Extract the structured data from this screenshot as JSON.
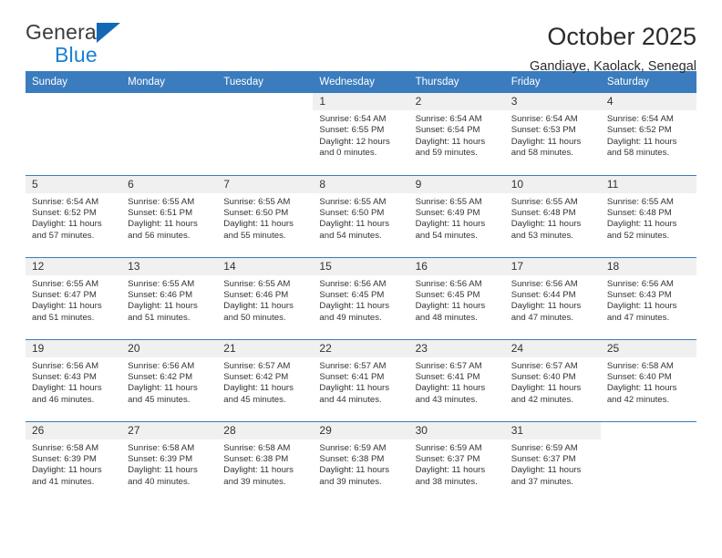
{
  "brand": {
    "name_top": "General",
    "name_bottom": "Blue",
    "accent_color": "#1368b5",
    "text_color": "#3b3b3b",
    "blue_text_color": "#1a7fd4"
  },
  "header": {
    "title": "October 2025",
    "subtitle": "Gandiaye, Kaolack, Senegal"
  },
  "theme": {
    "header_blue": "#3a7cbe",
    "daynum_band": "#f0f0f0",
    "body_text": "#333333"
  },
  "weekdays": [
    "Sunday",
    "Monday",
    "Tuesday",
    "Wednesday",
    "Thursday",
    "Friday",
    "Saturday"
  ],
  "weeks": [
    [
      {
        "day": "",
        "sunrise": "",
        "sunset": "",
        "daylight_1": "",
        "daylight_2": ""
      },
      {
        "day": "",
        "sunrise": "",
        "sunset": "",
        "daylight_1": "",
        "daylight_2": ""
      },
      {
        "day": "",
        "sunrise": "",
        "sunset": "",
        "daylight_1": "",
        "daylight_2": ""
      },
      {
        "day": "1",
        "sunrise": "Sunrise: 6:54 AM",
        "sunset": "Sunset: 6:55 PM",
        "daylight_1": "Daylight: 12 hours",
        "daylight_2": "and 0 minutes."
      },
      {
        "day": "2",
        "sunrise": "Sunrise: 6:54 AM",
        "sunset": "Sunset: 6:54 PM",
        "daylight_1": "Daylight: 11 hours",
        "daylight_2": "and 59 minutes."
      },
      {
        "day": "3",
        "sunrise": "Sunrise: 6:54 AM",
        "sunset": "Sunset: 6:53 PM",
        "daylight_1": "Daylight: 11 hours",
        "daylight_2": "and 58 minutes."
      },
      {
        "day": "4",
        "sunrise": "Sunrise: 6:54 AM",
        "sunset": "Sunset: 6:52 PM",
        "daylight_1": "Daylight: 11 hours",
        "daylight_2": "and 58 minutes."
      }
    ],
    [
      {
        "day": "5",
        "sunrise": "Sunrise: 6:54 AM",
        "sunset": "Sunset: 6:52 PM",
        "daylight_1": "Daylight: 11 hours",
        "daylight_2": "and 57 minutes."
      },
      {
        "day": "6",
        "sunrise": "Sunrise: 6:55 AM",
        "sunset": "Sunset: 6:51 PM",
        "daylight_1": "Daylight: 11 hours",
        "daylight_2": "and 56 minutes."
      },
      {
        "day": "7",
        "sunrise": "Sunrise: 6:55 AM",
        "sunset": "Sunset: 6:50 PM",
        "daylight_1": "Daylight: 11 hours",
        "daylight_2": "and 55 minutes."
      },
      {
        "day": "8",
        "sunrise": "Sunrise: 6:55 AM",
        "sunset": "Sunset: 6:50 PM",
        "daylight_1": "Daylight: 11 hours",
        "daylight_2": "and 54 minutes."
      },
      {
        "day": "9",
        "sunrise": "Sunrise: 6:55 AM",
        "sunset": "Sunset: 6:49 PM",
        "daylight_1": "Daylight: 11 hours",
        "daylight_2": "and 54 minutes."
      },
      {
        "day": "10",
        "sunrise": "Sunrise: 6:55 AM",
        "sunset": "Sunset: 6:48 PM",
        "daylight_1": "Daylight: 11 hours",
        "daylight_2": "and 53 minutes."
      },
      {
        "day": "11",
        "sunrise": "Sunrise: 6:55 AM",
        "sunset": "Sunset: 6:48 PM",
        "daylight_1": "Daylight: 11 hours",
        "daylight_2": "and 52 minutes."
      }
    ],
    [
      {
        "day": "12",
        "sunrise": "Sunrise: 6:55 AM",
        "sunset": "Sunset: 6:47 PM",
        "daylight_1": "Daylight: 11 hours",
        "daylight_2": "and 51 minutes."
      },
      {
        "day": "13",
        "sunrise": "Sunrise: 6:55 AM",
        "sunset": "Sunset: 6:46 PM",
        "daylight_1": "Daylight: 11 hours",
        "daylight_2": "and 51 minutes."
      },
      {
        "day": "14",
        "sunrise": "Sunrise: 6:55 AM",
        "sunset": "Sunset: 6:46 PM",
        "daylight_1": "Daylight: 11 hours",
        "daylight_2": "and 50 minutes."
      },
      {
        "day": "15",
        "sunrise": "Sunrise: 6:56 AM",
        "sunset": "Sunset: 6:45 PM",
        "daylight_1": "Daylight: 11 hours",
        "daylight_2": "and 49 minutes."
      },
      {
        "day": "16",
        "sunrise": "Sunrise: 6:56 AM",
        "sunset": "Sunset: 6:45 PM",
        "daylight_1": "Daylight: 11 hours",
        "daylight_2": "and 48 minutes."
      },
      {
        "day": "17",
        "sunrise": "Sunrise: 6:56 AM",
        "sunset": "Sunset: 6:44 PM",
        "daylight_1": "Daylight: 11 hours",
        "daylight_2": "and 47 minutes."
      },
      {
        "day": "18",
        "sunrise": "Sunrise: 6:56 AM",
        "sunset": "Sunset: 6:43 PM",
        "daylight_1": "Daylight: 11 hours",
        "daylight_2": "and 47 minutes."
      }
    ],
    [
      {
        "day": "19",
        "sunrise": "Sunrise: 6:56 AM",
        "sunset": "Sunset: 6:43 PM",
        "daylight_1": "Daylight: 11 hours",
        "daylight_2": "and 46 minutes."
      },
      {
        "day": "20",
        "sunrise": "Sunrise: 6:56 AM",
        "sunset": "Sunset: 6:42 PM",
        "daylight_1": "Daylight: 11 hours",
        "daylight_2": "and 45 minutes."
      },
      {
        "day": "21",
        "sunrise": "Sunrise: 6:57 AM",
        "sunset": "Sunset: 6:42 PM",
        "daylight_1": "Daylight: 11 hours",
        "daylight_2": "and 45 minutes."
      },
      {
        "day": "22",
        "sunrise": "Sunrise: 6:57 AM",
        "sunset": "Sunset: 6:41 PM",
        "daylight_1": "Daylight: 11 hours",
        "daylight_2": "and 44 minutes."
      },
      {
        "day": "23",
        "sunrise": "Sunrise: 6:57 AM",
        "sunset": "Sunset: 6:41 PM",
        "daylight_1": "Daylight: 11 hours",
        "daylight_2": "and 43 minutes."
      },
      {
        "day": "24",
        "sunrise": "Sunrise: 6:57 AM",
        "sunset": "Sunset: 6:40 PM",
        "daylight_1": "Daylight: 11 hours",
        "daylight_2": "and 42 minutes."
      },
      {
        "day": "25",
        "sunrise": "Sunrise: 6:58 AM",
        "sunset": "Sunset: 6:40 PM",
        "daylight_1": "Daylight: 11 hours",
        "daylight_2": "and 42 minutes."
      }
    ],
    [
      {
        "day": "26",
        "sunrise": "Sunrise: 6:58 AM",
        "sunset": "Sunset: 6:39 PM",
        "daylight_1": "Daylight: 11 hours",
        "daylight_2": "and 41 minutes."
      },
      {
        "day": "27",
        "sunrise": "Sunrise: 6:58 AM",
        "sunset": "Sunset: 6:39 PM",
        "daylight_1": "Daylight: 11 hours",
        "daylight_2": "and 40 minutes."
      },
      {
        "day": "28",
        "sunrise": "Sunrise: 6:58 AM",
        "sunset": "Sunset: 6:38 PM",
        "daylight_1": "Daylight: 11 hours",
        "daylight_2": "and 39 minutes."
      },
      {
        "day": "29",
        "sunrise": "Sunrise: 6:59 AM",
        "sunset": "Sunset: 6:38 PM",
        "daylight_1": "Daylight: 11 hours",
        "daylight_2": "and 39 minutes."
      },
      {
        "day": "30",
        "sunrise": "Sunrise: 6:59 AM",
        "sunset": "Sunset: 6:37 PM",
        "daylight_1": "Daylight: 11 hours",
        "daylight_2": "and 38 minutes."
      },
      {
        "day": "31",
        "sunrise": "Sunrise: 6:59 AM",
        "sunset": "Sunset: 6:37 PM",
        "daylight_1": "Daylight: 11 hours",
        "daylight_2": "and 37 minutes."
      },
      {
        "day": "",
        "sunrise": "",
        "sunset": "",
        "daylight_1": "",
        "daylight_2": ""
      }
    ]
  ]
}
